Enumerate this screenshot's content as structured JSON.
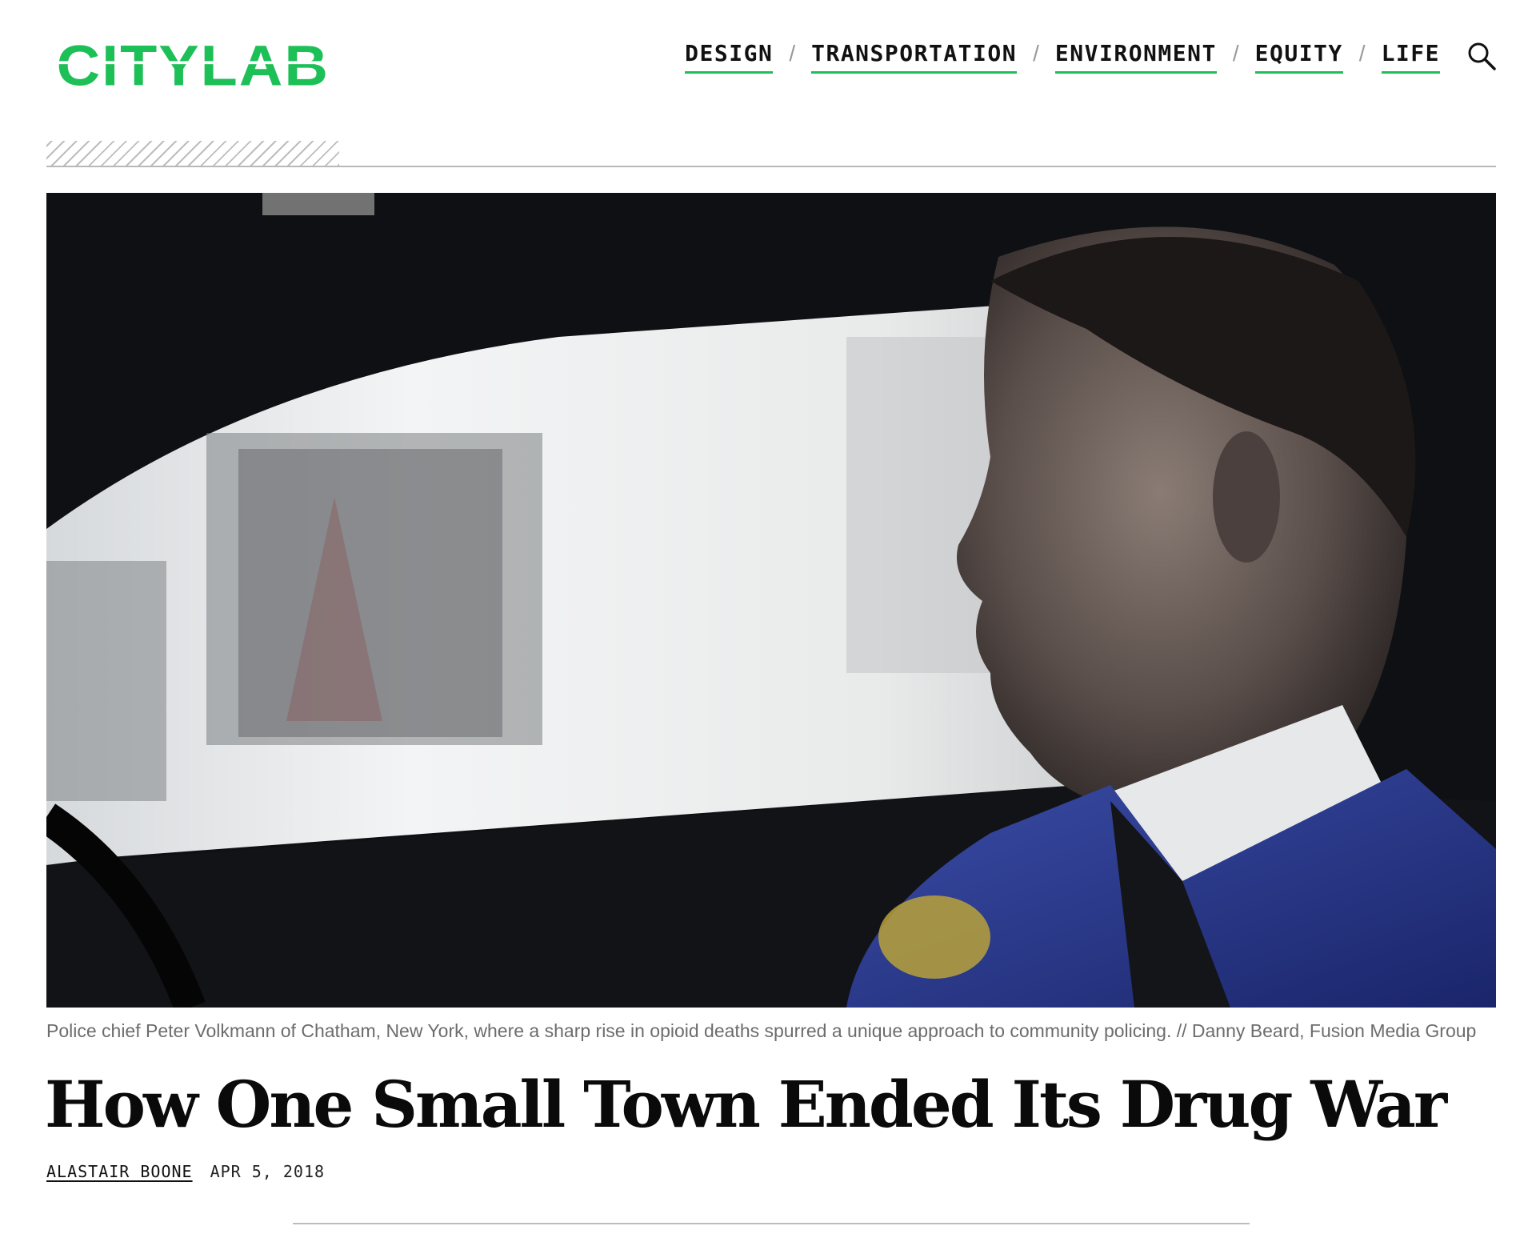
{
  "site": {
    "logo_text": "CITYLAB",
    "brand_color": "#1dbf57"
  },
  "nav": {
    "items": [
      {
        "label": "DESIGN"
      },
      {
        "label": "TRANSPORTATION"
      },
      {
        "label": "ENVIRONMENT"
      },
      {
        "label": "EQUITY"
      },
      {
        "label": "LIFE"
      }
    ],
    "separator": "/",
    "search_icon": "search-icon"
  },
  "hero": {
    "caption": "Police chief Peter Volkmann of Chatham, New York, where a sharp rise in opioid deaths spurred a unique approach to community policing. // Danny Beard, Fusion Media Group"
  },
  "article": {
    "title": "How One Small Town Ended Its Drug War",
    "author": "ALASTAIR BOONE",
    "date": "APR 5, 2018"
  }
}
